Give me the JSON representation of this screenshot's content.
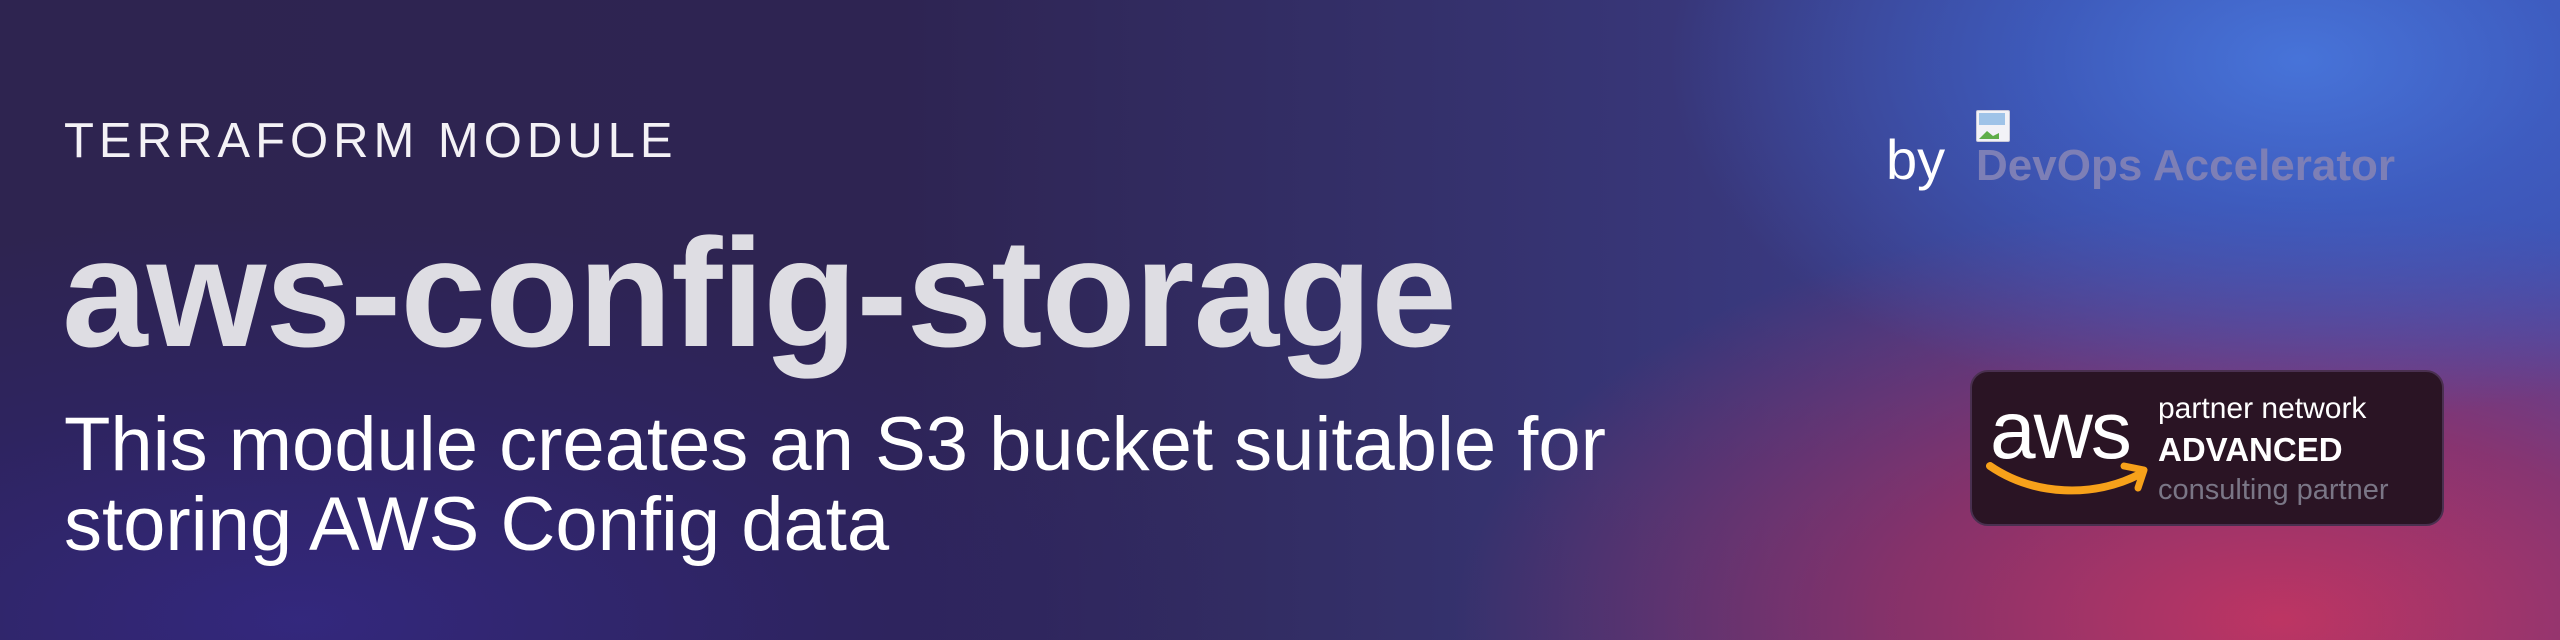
{
  "banner": {
    "eyebrow": "TERRAFORM MODULE",
    "title": "aws-config-storage",
    "subtitle": "This module creates an S3 bucket suitable for storing AWS Config data"
  },
  "attribution": {
    "by_label": "by",
    "brand_alt": "DevOps Accelerator"
  },
  "partner_badge": {
    "wordmark": "aws",
    "line1": "partner network",
    "line2": "ADVANCED",
    "line3": "consulting partner",
    "smile_color": "#f7a11a"
  },
  "colors": {
    "title": "#dedde3",
    "brand_alt_text": "#7d7fb6",
    "badge_bg": "#2a1424"
  }
}
